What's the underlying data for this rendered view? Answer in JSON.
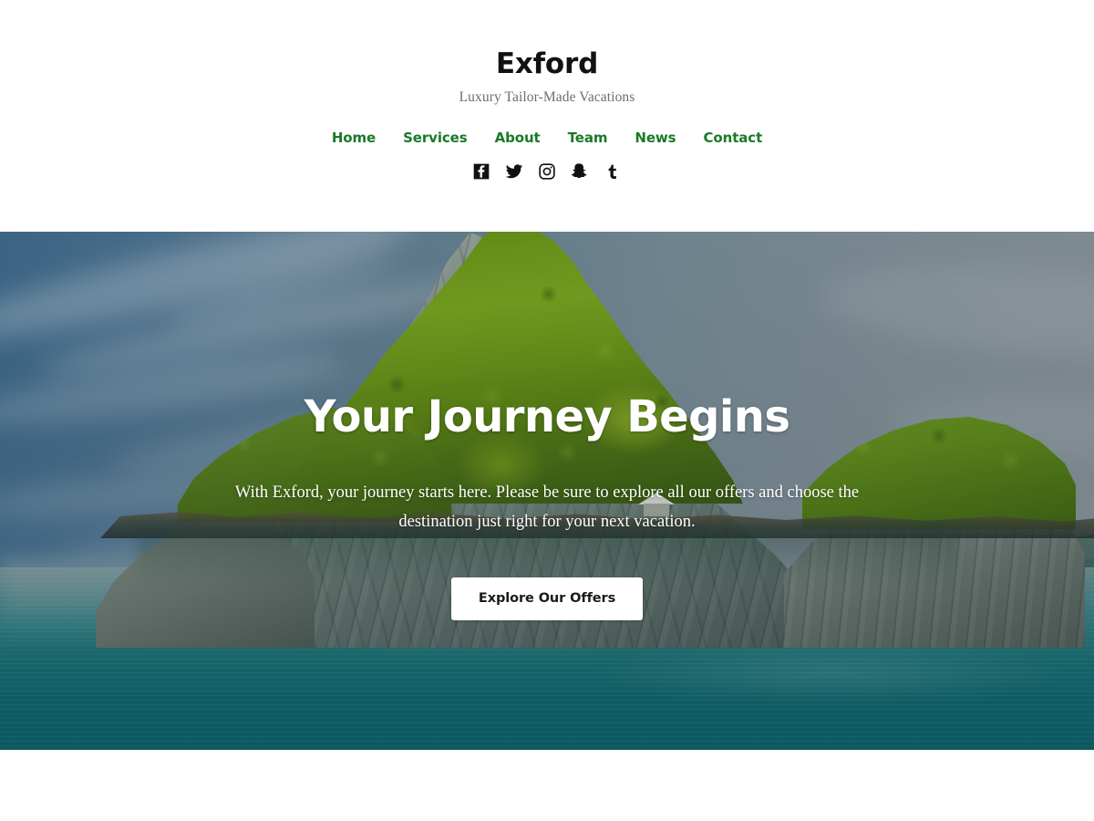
{
  "header": {
    "site_title": "Exford",
    "tagline": "Luxury Tailor-Made Vacations",
    "nav": [
      {
        "label": "Home",
        "name": "nav-link-home"
      },
      {
        "label": "Services",
        "name": "nav-link-services"
      },
      {
        "label": "About",
        "name": "nav-link-about"
      },
      {
        "label": "Team",
        "name": "nav-link-team"
      },
      {
        "label": "News",
        "name": "nav-link-news"
      },
      {
        "label": "Contact",
        "name": "nav-link-contact"
      }
    ],
    "social": [
      {
        "icon": "facebook-icon",
        "label": "Facebook"
      },
      {
        "icon": "twitter-icon",
        "label": "Twitter"
      },
      {
        "icon": "instagram-icon",
        "label": "Instagram"
      },
      {
        "icon": "snapchat-icon",
        "label": "Snapchat"
      },
      {
        "icon": "tumblr-icon",
        "label": "Tumblr"
      }
    ]
  },
  "hero": {
    "title": "Your Journey Begins",
    "paragraph": "With Exford, your journey starts here. Please be sure to explore all our offers and choose the destination just right for your next vacation.",
    "cta_label": "Explore Our Offers",
    "image_alt": "Tropical limestone karst island covered in green jungle, surrounded by turquoise sea under a cloudy blue-grey sky"
  },
  "colors": {
    "page_background": "#ffffff",
    "site_title": "#111111",
    "tagline": "#6d6d6d",
    "nav_link_green": "#1a7a28",
    "social_icon": "#111111",
    "hero_text": "#ffffff",
    "cta_background": "#ffffff",
    "cta_text": "#1b1b1b",
    "sky_left": "#3f6b8c",
    "sky_right": "#8a959c",
    "sea_shallow": "#6d8f92",
    "sea_deep": "#0d5c64",
    "foliage_light": "#7aa425",
    "foliage_dark": "#3a5a16",
    "rock_light": "#9aa69e",
    "rock_dark": "#4b5b57"
  }
}
